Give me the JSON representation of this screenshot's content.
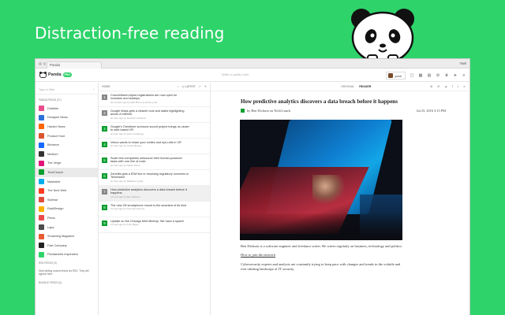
{
  "headline": "Distraction-free reading",
  "browser": {
    "tab_title": "Panda",
    "user": "Yael"
  },
  "appbar": {
    "brand": "Panda",
    "badge": "PRO",
    "search_placeholder": "Write to public here",
    "username": "yeah"
  },
  "sidebar": {
    "filter_placeholder": "Type to filter",
    "panda_feeds_header": "PANDA FEEDS (27)",
    "feeds": [
      {
        "label": "Dribbble",
        "color": "#e94d8b"
      },
      {
        "label": "Designer News",
        "color": "#2d72d9"
      },
      {
        "label": "Hacker News",
        "color": "#ff6600"
      },
      {
        "label": "Product Hunt",
        "color": "#da552f"
      },
      {
        "label": "Behance",
        "color": "#1769ff"
      },
      {
        "label": "Medium",
        "color": "#333333"
      },
      {
        "label": "The Verge",
        "color": "#e2127a"
      },
      {
        "label": "TechCrunch",
        "color": "#0a9e2f"
      },
      {
        "label": "Mashable",
        "color": "#00aeef"
      },
      {
        "label": "The Next Web",
        "color": "#ff3c1f"
      },
      {
        "label": "Sidebar",
        "color": "#e04e39"
      },
      {
        "label": "RadiiDesign",
        "color": "#ffb000"
      },
      {
        "label": "Pttrns",
        "color": "#ea4c4c"
      },
      {
        "label": "Lapa",
        "color": "#4d4d4d"
      },
      {
        "label": "Smashing Magazine",
        "color": "#e85c33"
      },
      {
        "label": "Fast Company",
        "color": "#222222"
      },
      {
        "label": "Pandarulela Inspiration",
        "color": "#2ed36a"
      }
    ],
    "rss_header": "RSS FEEDS (0)",
    "rss_note": "Start adding custom feeds via RSS. They will appear here.",
    "bundle_header": "BUNDLE FEEDS (0)"
  },
  "list": {
    "section": "HOME",
    "sort_label": "LATEST",
    "items": [
      {
        "num": "1",
        "title": "CrunchMatch Alpha registrations are now open for investors and startups",
        "meta": "20 minutes ago by Matt Burns & Anthony Ha",
        "color": "#888888",
        "selected": false
      },
      {
        "num": "2",
        "title": "Google Maps gets a cleaner look and starts highlighting areas of interest",
        "meta": "an hour ago by Frederic Lardinois",
        "color": "#888888",
        "selected": false
      },
      {
        "num": "3",
        "title": "Google's Omnitone surround sound project brings us closer to web-based VR",
        "meta": "an hour ago by Devin Coldewey",
        "color": "#0a9e2f",
        "selected": false
      },
      {
        "num": "4",
        "title": "Vesoo wants to share your smiles and eye-rolls in VR",
        "meta": "an hour ago by Lucas Matney",
        "color": "#0a9e2f",
        "selected": false
      },
      {
        "num": "5",
        "title": "Scale lets companies outsource their human-powered tasks with one line of code",
        "meta": "an hour ago by Sarah Perez",
        "color": "#0a9e2f",
        "selected": false
      },
      {
        "num": "6",
        "title": "Zenefits gets a $7M fine in resolving regulatory concerns in Tennessee",
        "meta": "an hour ago by Matthew Lynley",
        "color": "#0a9e2f",
        "selected": false
      },
      {
        "num": "7",
        "title": "How predictive analytics discovers a data breach before it happens",
        "meta": "2 hours ago by Ben Dickson",
        "color": "#888888",
        "selected": true
      },
      {
        "num": "8",
        "title": "The new Gif smartphone mount is the smartest of its kind",
        "meta": "2 hours ago by Kyle Del Hermes",
        "color": "#0a9e2f",
        "selected": false
      },
      {
        "num": "9",
        "title": "Update on the Chicago Mint Meetup: We have a space!",
        "meta": "2 hours ago by John Biggs",
        "color": "#0a9e2f",
        "selected": false
      }
    ]
  },
  "reader": {
    "tab_original": "ORIGINAL",
    "tab_reader": "READER",
    "title": "How predictive analytics discovers a data breach before it happens",
    "byline": "by Ben Dickson on TechCrunch",
    "date": "Jul 25, 2016 3:15 PM",
    "bio": "Ben Dickson is a software engineer and freelance writer. He writes regularly on business, technology and politics.",
    "link": "How to join the network",
    "body": "Cybersecurity experts and analysts are constantly trying to keep pace with changes and trends in the volatile and ever-shifting landscape of IT security."
  },
  "colors": {
    "accent": "#2ed36a",
    "techcrunch": "#0a9e2f"
  }
}
